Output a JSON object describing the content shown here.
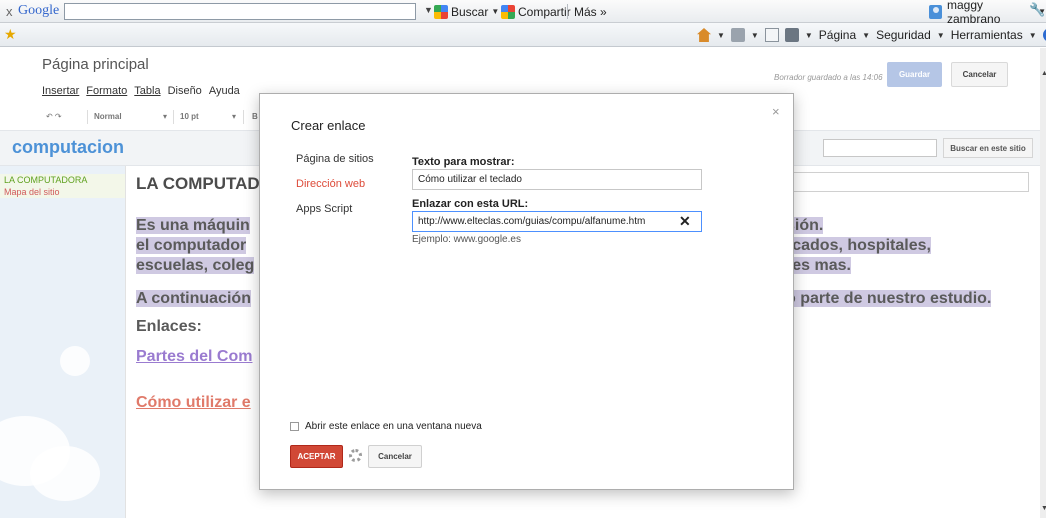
{
  "google_toolbar": {
    "close": "x",
    "logo": "Google",
    "search_value": "",
    "buscar": "Buscar",
    "compartir": "Compartir",
    "mas": "Más »",
    "user": "maggy zambrano"
  },
  "command_bar": {
    "pagina": "Página",
    "seguridad": "Seguridad",
    "herramientas": "Herramientas"
  },
  "editor": {
    "page_title": "Página principal",
    "menu": [
      "Insertar",
      "Formato",
      "Tabla",
      "Diseño",
      "Ayuda"
    ],
    "draft_status": "Borrador guardado a las 14:06",
    "save": "Guardar",
    "cancel": "Cancelar",
    "format": {
      "style": "Normal",
      "size": "10 pt",
      "bold": "B"
    }
  },
  "site": {
    "name": "computacion",
    "search_button": "Buscar en este sitio",
    "sidebar": [
      "LA COMPUTADORA",
      "Mapa del sitio"
    ]
  },
  "content": {
    "title_visible": "LA COMPUTADO",
    "left_lines": [
      "Es una máquin",
      "el computador",
      "escuelas, coleg",
      "A continuación"
    ],
    "right_lines": [
      "sión.",
      "rcados, hospitales,",
      "res mas.",
      "o parte de  nuestro estudio."
    ],
    "enlaces": "Enlaces:",
    "link_partes": "Partes del Com",
    "link_como": "Cómo utilizar e"
  },
  "dialog": {
    "title": "Crear enlace",
    "close": "×",
    "nav": [
      "Página de sitios",
      "Dirección web",
      "Apps Script"
    ],
    "active_nav": "Dirección web",
    "text_label": "Texto para mostrar:",
    "text_value": "Cómo utilizar el teclado",
    "url_label": "Enlazar con esta URL:",
    "url_value": "http://www.elteclas.com/guias/compu/alfanume.htm",
    "example": "Ejemplo: www.google.es",
    "new_window_label": "Abrir este enlace en una ventana nueva",
    "new_window_checked": false,
    "accept": "ACEPTAR",
    "cancel": "Cancelar"
  },
  "colors": {
    "accent_red": "#d14836",
    "link_blue": "#4d92d7",
    "highlight": "#cfc9e2"
  }
}
